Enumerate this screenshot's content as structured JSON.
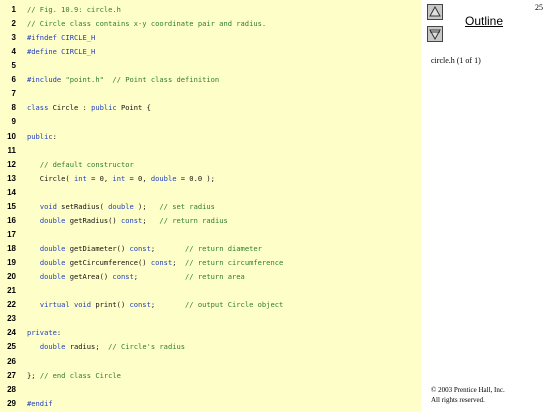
{
  "slide": {
    "page_number": "25",
    "outline_label": "Outline",
    "file_reference": "circle.h (1 of 1)",
    "copyright_line1": "© 2003 Prentice Hall, Inc.",
    "copyright_line2": "All rights reserved."
  },
  "code": [
    {
      "n": "1",
      "segs": [
        [
          "c",
          "// Fig. 10.9: circle.h"
        ]
      ]
    },
    {
      "n": "2",
      "segs": [
        [
          "c",
          "// Circle class contains x-y coordinate pair and radius."
        ]
      ]
    },
    {
      "n": "3",
      "segs": [
        [
          "p",
          "#ifndef CIRCLE_H"
        ]
      ]
    },
    {
      "n": "4",
      "segs": [
        [
          "p",
          "#define CIRCLE_H"
        ]
      ]
    },
    {
      "n": "5",
      "segs": []
    },
    {
      "n": "6",
      "segs": [
        [
          "p",
          "#include "
        ],
        [
          "s",
          "\"point.h\""
        ],
        [
          "n",
          "  "
        ],
        [
          "c",
          "// Point class definition"
        ]
      ]
    },
    {
      "n": "7",
      "segs": []
    },
    {
      "n": "8",
      "segs": [
        [
          "k",
          "class "
        ],
        [
          "n",
          "Circle : "
        ],
        [
          "k",
          "public "
        ],
        [
          "n",
          "Point {"
        ]
      ]
    },
    {
      "n": "9",
      "segs": []
    },
    {
      "n": "10",
      "segs": [
        [
          "k",
          "public"
        ],
        [
          "n",
          ":"
        ]
      ]
    },
    {
      "n": "11",
      "segs": []
    },
    {
      "n": "12",
      "segs": [
        [
          "n",
          "   "
        ],
        [
          "c",
          "// default constructor"
        ]
      ]
    },
    {
      "n": "13",
      "segs": [
        [
          "n",
          "   Circle( "
        ],
        [
          "k",
          "int"
        ],
        [
          "n",
          " = 0, "
        ],
        [
          "k",
          "int"
        ],
        [
          "n",
          " = 0, "
        ],
        [
          "k",
          "double"
        ],
        [
          "n",
          " = 0.0 );"
        ]
      ]
    },
    {
      "n": "14",
      "segs": []
    },
    {
      "n": "15",
      "segs": [
        [
          "n",
          "   "
        ],
        [
          "k",
          "void"
        ],
        [
          "n",
          " setRadius( "
        ],
        [
          "k",
          "double"
        ],
        [
          "n",
          " );   "
        ],
        [
          "c",
          "// set radius"
        ]
      ]
    },
    {
      "n": "16",
      "segs": [
        [
          "n",
          "   "
        ],
        [
          "k",
          "double"
        ],
        [
          "n",
          " getRadius() "
        ],
        [
          "k",
          "const"
        ],
        [
          "n",
          ";   "
        ],
        [
          "c",
          "// return radius"
        ]
      ]
    },
    {
      "n": "17",
      "segs": []
    },
    {
      "n": "18",
      "segs": [
        [
          "n",
          "   "
        ],
        [
          "k",
          "double"
        ],
        [
          "n",
          " getDiameter() "
        ],
        [
          "k",
          "const"
        ],
        [
          "n",
          ";       "
        ],
        [
          "c",
          "// return diameter"
        ]
      ]
    },
    {
      "n": "19",
      "segs": [
        [
          "n",
          "   "
        ],
        [
          "k",
          "double"
        ],
        [
          "n",
          " getCircumference() "
        ],
        [
          "k",
          "const"
        ],
        [
          "n",
          ";  "
        ],
        [
          "c",
          "// return circumference"
        ]
      ]
    },
    {
      "n": "20",
      "segs": [
        [
          "n",
          "   "
        ],
        [
          "k",
          "double"
        ],
        [
          "n",
          " getArea() "
        ],
        [
          "k",
          "const"
        ],
        [
          "n",
          ";           "
        ],
        [
          "c",
          "// return area"
        ]
      ]
    },
    {
      "n": "21",
      "segs": []
    },
    {
      "n": "22",
      "segs": [
        [
          "n",
          "   "
        ],
        [
          "k",
          "virtual void"
        ],
        [
          "n",
          " print() "
        ],
        [
          "k",
          "const"
        ],
        [
          "n",
          ";       "
        ],
        [
          "c",
          "// output Circle object"
        ]
      ]
    },
    {
      "n": "23",
      "segs": []
    },
    {
      "n": "24",
      "segs": [
        [
          "k",
          "private"
        ],
        [
          "n",
          ":"
        ]
      ]
    },
    {
      "n": "25",
      "segs": [
        [
          "n",
          "   "
        ],
        [
          "k",
          "double"
        ],
        [
          "n",
          " radius;  "
        ],
        [
          "c",
          "// Circle's radius"
        ]
      ]
    },
    {
      "n": "26",
      "segs": []
    },
    {
      "n": "27",
      "segs": [
        [
          "n",
          "}; "
        ],
        [
          "c",
          "// end class Circle"
        ]
      ]
    },
    {
      "n": "28",
      "segs": []
    },
    {
      "n": "29",
      "segs": [
        [
          "p",
          "#endif"
        ]
      ]
    }
  ],
  "icons": {
    "prev": "arrow-up-icon",
    "next": "arrow-down-icon"
  }
}
